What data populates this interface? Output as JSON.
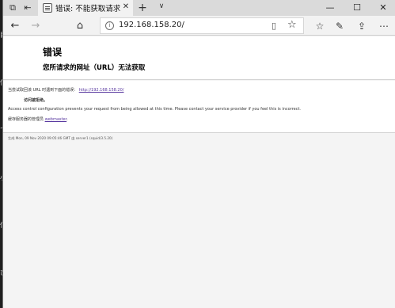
{
  "desktop": {
    "chars": [
      "目",
      "信",
      "て",
      "小",
      "信",
      "び"
    ]
  },
  "tab": {
    "title": "错误: 不能获取请求的 U"
  },
  "address": {
    "url": "192.168.158.20/"
  },
  "page": {
    "title": "错误",
    "subtitle": "您所请求的网址（URL）无法获取",
    "attempt_prefix": "当尝试取回该 URL 时遇到下面的错误：",
    "attempt_url": "http://192.168.158.20/",
    "denied": "访问被拒绝。",
    "message": "Access control configuration prevents your request from being allowed at this time. Please contact your service provider if you feel this is incorrect.",
    "contact_prefix": "缓存服务器的管理员",
    "contact_link": "webmaster",
    "contact_suffix": ".",
    "footer": "生成 Mon, 09 Nov 2020 09:05:46 GMT 由 server1 (squid/3.5.20)"
  },
  "icons": {
    "tab_aside": "tab-aside-icon",
    "tab_preview": "tab-preview-icon",
    "favicon": "page-favicon-icon",
    "close": "close-icon",
    "new_tab": "plus-icon",
    "tab_menu": "chevron-down-icon",
    "minimize": "minimize-icon",
    "maximize": "maximize-icon",
    "window_close": "window-close-icon",
    "back": "back-arrow-icon",
    "forward": "forward-arrow-icon",
    "home": "home-icon",
    "info": "info-icon",
    "reading_view": "reading-view-icon",
    "favorite": "star-icon",
    "favorites_hub": "favorites-hub-icon",
    "notes": "pen-icon",
    "share": "share-icon",
    "more": "more-icon"
  }
}
